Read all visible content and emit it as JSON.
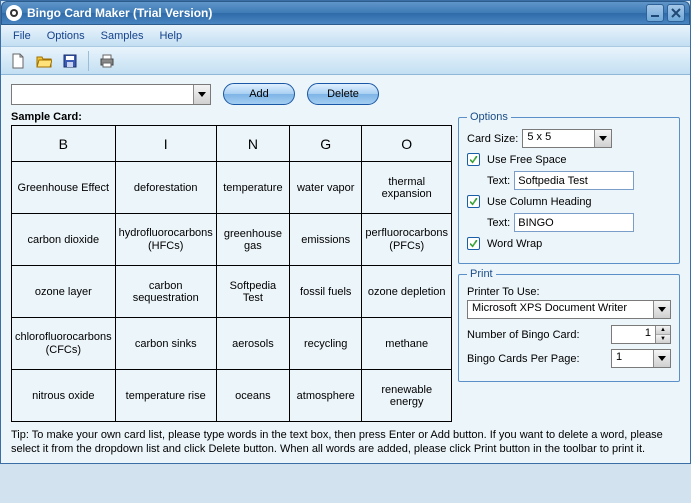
{
  "window": {
    "title": "Bingo Card Maker (Trial Version)"
  },
  "menubar": {
    "items": [
      "File",
      "Options",
      "Samples",
      "Help"
    ]
  },
  "toolbar": {
    "icons": [
      "new-file-icon",
      "open-file-icon",
      "save-icon",
      "print-icon"
    ]
  },
  "word_combo": {
    "value": ""
  },
  "buttons": {
    "add": "Add",
    "delete": "Delete"
  },
  "sample_label": "Sample Card:",
  "card": {
    "headers": [
      "B",
      "I",
      "N",
      "G",
      "O"
    ],
    "rows": [
      [
        "Greenhouse Effect",
        "deforestation",
        "temperature",
        "water vapor",
        "thermal expansion"
      ],
      [
        "carbon dioxide",
        "hydrofluorocarbons (HFCs)",
        "greenhouse gas",
        "emissions",
        "perfluorocarbons (PFCs)"
      ],
      [
        "ozone layer",
        "carbon sequestration",
        "Softpedia Test",
        "fossil fuels",
        "ozone depletion"
      ],
      [
        "chlorofluorocarbons (CFCs)",
        "carbon sinks",
        "aerosols",
        "recycling",
        "methane"
      ],
      [
        "nitrous oxide",
        "temperature rise",
        "oceans",
        "atmosphere",
        "renewable energy"
      ]
    ]
  },
  "options": {
    "legend": "Options",
    "card_size_label": "Card Size:",
    "card_size_value": "5 x 5",
    "use_free_space": {
      "checked": true,
      "label": "Use Free Space",
      "text_label": "Text:",
      "text_value": "Softpedia Test"
    },
    "use_column_heading": {
      "checked": true,
      "label": "Use Column Heading",
      "text_label": "Text:",
      "text_value": "BINGO"
    },
    "word_wrap": {
      "checked": true,
      "label": "Word Wrap"
    }
  },
  "print": {
    "legend": "Print",
    "printer_label": "Printer To Use:",
    "printer_value": "Microsoft XPS Document Writer",
    "num_cards_label": "Number of Bingo Card:",
    "num_cards_value": "1",
    "cards_per_page_label": "Bingo Cards Per Page:",
    "cards_per_page_value": "1"
  },
  "tip": "Tip: To make your own card list, please type words in the text box, then press Enter or Add button. If you want to delete a word, please select it from the dropdown list and click Delete button. When all words are added, please click Print button in the toolbar to print it."
}
